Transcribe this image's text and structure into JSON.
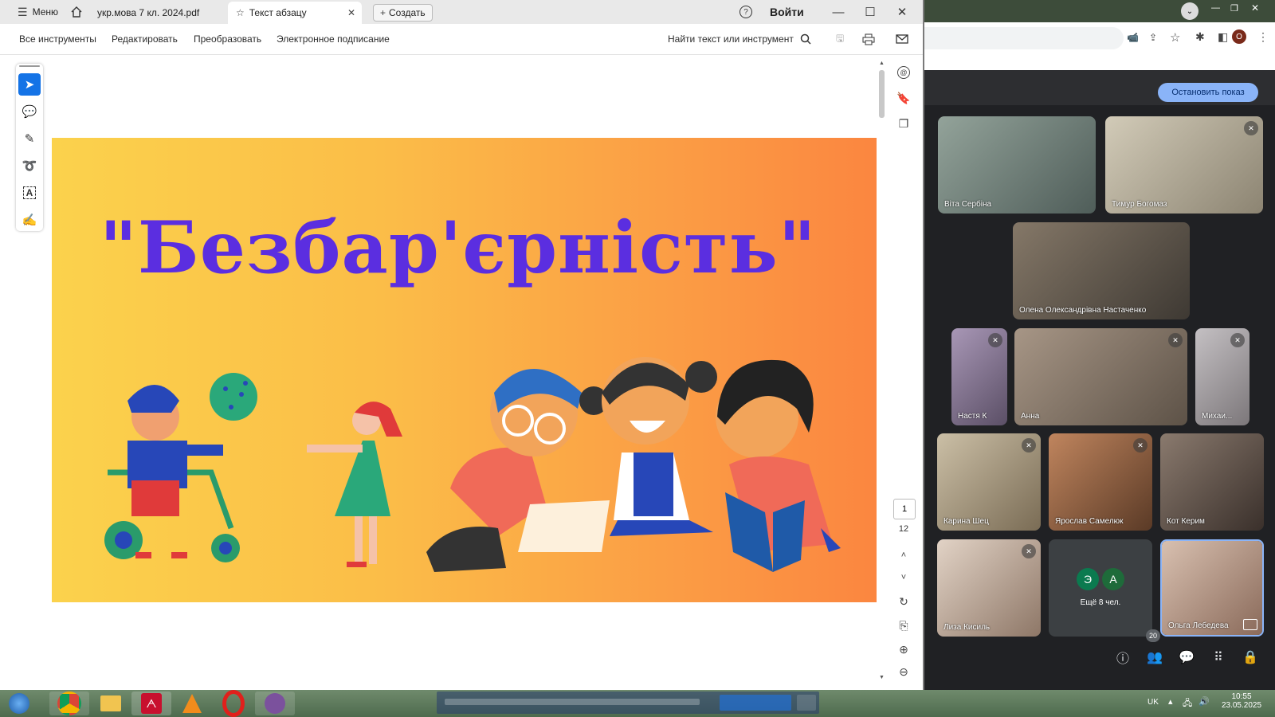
{
  "acrobat": {
    "menu_label": "Меню",
    "tabs": [
      {
        "label": "укр.мова 7 кл. 2024.pdf"
      },
      {
        "label": "Текст абзацу"
      }
    ],
    "create_label": "Создать",
    "signin_label": "Войти",
    "menu": {
      "all_tools": "Все инструменты",
      "edit": "Редактировать",
      "convert": "Преобразовать",
      "esign": "Электронное подписание",
      "search": "Найти текст или инструмент"
    },
    "slide_title": "\"Безбар'єрність\"",
    "page_current": "1",
    "page_total": "12",
    "icons": [
      "home-icon",
      "star-icon",
      "close-icon",
      "plus-icon",
      "help-icon",
      "search-icon",
      "save-icon",
      "print-icon",
      "mail-icon",
      "cursor-icon",
      "comment-icon",
      "pen-icon",
      "lasso-icon",
      "text-select-icon",
      "signature-icon",
      "ai-icon",
      "bookmark-icon",
      "pages-icon",
      "rotate-icon",
      "export-icon",
      "zoom-in-icon",
      "zoom-out-icon"
    ]
  },
  "meet": {
    "stop_presenting": "Остановить показ",
    "participants": [
      {
        "name": "Віта Сербіна",
        "muted": false,
        "color": "#7d8c84"
      },
      {
        "name": "Тимур Богомаз",
        "muted": true,
        "color": "#b8b2a0"
      },
      {
        "name": "Олена Олександрівна Настаченко",
        "muted": false,
        "color": "#6e6458"
      },
      {
        "name": "Настя К",
        "muted": true,
        "color": "#8d7d9a"
      },
      {
        "name": "Анна",
        "muted": true,
        "color": "#8a7c70"
      },
      {
        "name": "Михаи...",
        "muted": true,
        "color": "#a9a5a8"
      },
      {
        "name": "Карина Шец",
        "muted": true,
        "color": "#b2a58e"
      },
      {
        "name": "Ярослав Самелюк",
        "muted": true,
        "color": "#9a7055"
      },
      {
        "name": "Кот Керим",
        "muted": false,
        "color": "#6d5d52"
      },
      {
        "name": "Лиза Кисиль",
        "muted": true,
        "color": "#c9b6a8"
      },
      {
        "name": "Ольга Лебедева",
        "muted": false,
        "color": "#bfa596"
      }
    ],
    "more_avatars": [
      "Э",
      "А"
    ],
    "more_label": "Ещё 8 чел.",
    "participant_count": "20"
  },
  "taskbar": {
    "lang": "UK",
    "time": "10:55",
    "date": "23.05.2025"
  },
  "colors": {
    "accent_blue": "#1473e6",
    "slide_title": "#5b2ee0",
    "meet_button": "#8ab4f8"
  }
}
